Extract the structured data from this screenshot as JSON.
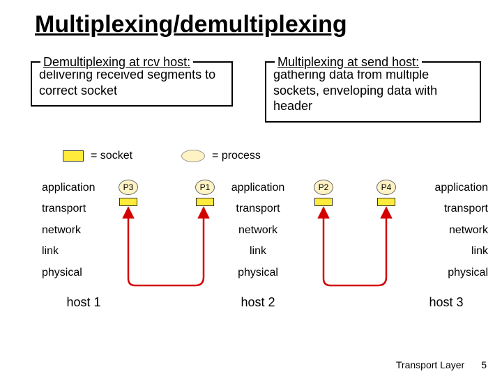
{
  "title": "Multiplexing/demultiplexing",
  "left_box": {
    "legend": "Demultiplexing at rcv host:",
    "body": "delivering received segments to correct socket"
  },
  "right_box": {
    "legend": "Multiplexing at send host:",
    "body": "gathering data from multiple sockets, enveloping data with header"
  },
  "legend_row": {
    "socket": "= socket",
    "process": "= process"
  },
  "layers": [
    "application",
    "transport",
    "network",
    "link",
    "physical"
  ],
  "processes": {
    "p1": "P1",
    "p2": "P2",
    "p3": "P3",
    "p4": "P4"
  },
  "hosts": {
    "h1": "host 1",
    "h2": "host 2",
    "h3": "host 3"
  },
  "footer": {
    "label": "Transport Layer",
    "page": "5"
  }
}
